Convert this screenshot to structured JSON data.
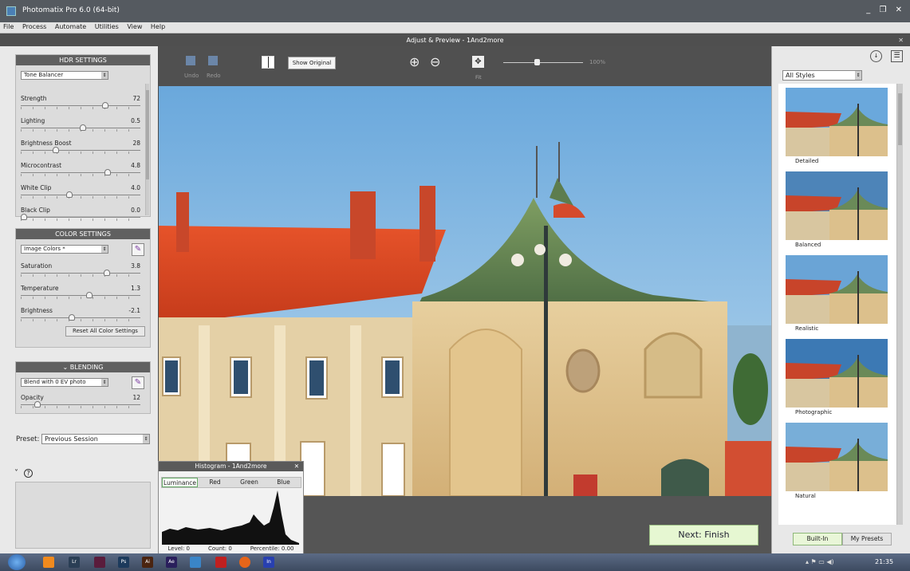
{
  "window": {
    "title": "Photomatix Pro 6.0 (64-bit)",
    "controls": "_ ❐ ✕"
  },
  "menu": [
    "File",
    "Process",
    "Automate",
    "Utilities",
    "View",
    "Help"
  ],
  "subtitle": "Adjust & Preview - 1And2more",
  "hdr": {
    "header": "HDR SETTINGS",
    "method": "Tone Balancer",
    "sliders": [
      {
        "label": "Strength",
        "value": "72",
        "pos": 0.72
      },
      {
        "label": "Lighting",
        "value": "0.5",
        "pos": 0.52
      },
      {
        "label": "Brightness Boost",
        "value": "28",
        "pos": 0.28
      },
      {
        "label": "Microcontrast",
        "value": "4.8",
        "pos": 0.74
      },
      {
        "label": "White Clip",
        "value": "4.0",
        "pos": 0.4
      },
      {
        "label": "Black Clip",
        "value": "0.0",
        "pos": 0.0
      }
    ]
  },
  "color": {
    "header": "COLOR SETTINGS",
    "mode": "Image Colors *",
    "sliders": [
      {
        "label": "Saturation",
        "value": "3.8",
        "pos": 0.73
      },
      {
        "label": "Temperature",
        "value": "1.3",
        "pos": 0.58
      },
      {
        "label": "Brightness",
        "value": "-2.1",
        "pos": 0.42
      }
    ],
    "reset_label": "Reset All Color Settings"
  },
  "blending": {
    "header": "BLENDING",
    "mode": "Blend with 0 EV photo",
    "opacity_label": "Opacity",
    "opacity_value": "12",
    "opacity_pos": 0.12
  },
  "preset": {
    "label": "Preset:",
    "value": "Previous Session"
  },
  "toolbar": {
    "undo": "Undo",
    "redo": "Redo",
    "show_original": "Show Original",
    "fit": "Fit",
    "zoom": "100%",
    "zoom_pos": 0.42
  },
  "next_label": "Next: Finish",
  "styles": {
    "filter": "All Styles",
    "items": [
      "Detailed",
      "Balanced",
      "Realistic",
      "Photographic",
      "Natural"
    ],
    "tabs": [
      "Built-In",
      "My Presets"
    ]
  },
  "histogram": {
    "title": "Histogram - 1And2more",
    "tabs": [
      "Luminance",
      "Red",
      "Green",
      "Blue"
    ],
    "level": "Level: 0",
    "count": "Count: 0",
    "percentile": "Percentile: 0.00"
  },
  "taskbar": {
    "clock": "21:35",
    "apps": [
      "Lr",
      "Ps",
      "Ai",
      "Ae",
      "In"
    ]
  }
}
